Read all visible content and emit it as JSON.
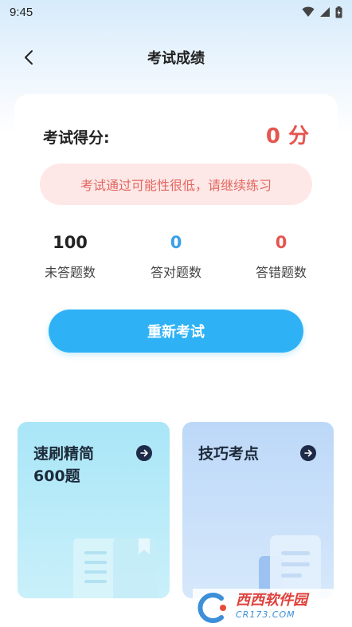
{
  "status_bar": {
    "time": "9:45"
  },
  "nav": {
    "title": "考试成绩"
  },
  "score": {
    "label": "考试得分:",
    "value": "0",
    "unit": "分"
  },
  "notice": "考试通过可能性很低，请继续练习",
  "stats": [
    {
      "value": "100",
      "label": "未答题数",
      "color": "#222222"
    },
    {
      "value": "0",
      "label": "答对题数",
      "color": "#3a9ee8"
    },
    {
      "value": "0",
      "label": "答错题数",
      "color": "#e4564f"
    }
  ],
  "retry_button": "重新考试",
  "tiles": [
    {
      "title_line1": "速刷精简",
      "title_line2": "600题"
    },
    {
      "title_line1": "技巧考点"
    }
  ],
  "watermark": {
    "brand": "西西软件园",
    "url": "CR173.COM"
  },
  "colors": {
    "accent": "#2eb2f5",
    "danger": "#e4564f",
    "notice_bg": "#fde8e7"
  }
}
